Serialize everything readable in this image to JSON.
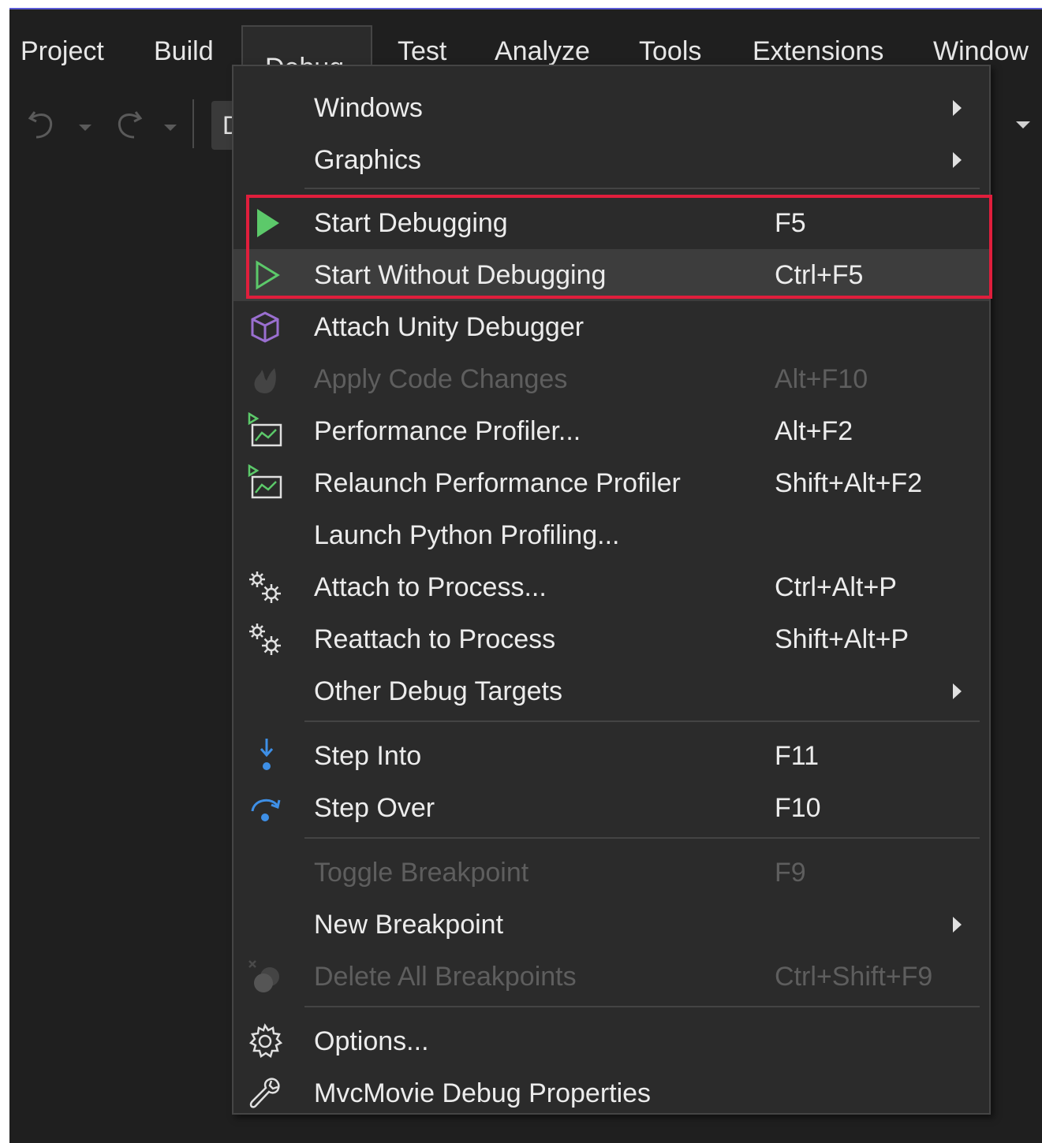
{
  "menubar": {
    "items": [
      "Project",
      "Build",
      "Debug",
      "Test",
      "Analyze",
      "Tools",
      "Extensions",
      "Window"
    ]
  },
  "toolbar": {
    "config_label": "D",
    "icons": [
      "undo-icon",
      "redo-icon"
    ]
  },
  "debug_menu": {
    "items": [
      {
        "label": "Windows",
        "shortcut": "",
        "submenu": true,
        "icon": ""
      },
      {
        "label": "Graphics",
        "shortcut": "",
        "submenu": true,
        "icon": ""
      },
      {
        "label": "Start Debugging",
        "shortcut": "F5",
        "icon": "play-filled-icon"
      },
      {
        "label": "Start Without Debugging",
        "shortcut": "Ctrl+F5",
        "icon": "play-outline-icon"
      },
      {
        "label": "Attach Unity Debugger",
        "shortcut": "",
        "icon": "unity-cube-icon"
      },
      {
        "label": "Apply Code Changes",
        "shortcut": "Alt+F10",
        "icon": "flame-icon",
        "disabled": true
      },
      {
        "label": "Performance Profiler...",
        "shortcut": "Alt+F2",
        "icon": "profiler-icon"
      },
      {
        "label": "Relaunch Performance Profiler",
        "shortcut": "Shift+Alt+F2",
        "icon": "profiler-icon"
      },
      {
        "label": "Launch Python Profiling...",
        "shortcut": "",
        "icon": ""
      },
      {
        "label": "Attach to Process...",
        "shortcut": "Ctrl+Alt+P",
        "icon": "gears-icon"
      },
      {
        "label": "Reattach to Process",
        "shortcut": "Shift+Alt+P",
        "icon": "gears-icon"
      },
      {
        "label": "Other Debug Targets",
        "shortcut": "",
        "submenu": true,
        "icon": ""
      },
      {
        "label": "Step Into",
        "shortcut": "F11",
        "icon": "step-into-icon"
      },
      {
        "label": "Step Over",
        "shortcut": "F10",
        "icon": "step-over-icon"
      },
      {
        "label": "Toggle Breakpoint",
        "shortcut": "F9",
        "icon": "",
        "disabled": true
      },
      {
        "label": "New Breakpoint",
        "shortcut": "",
        "submenu": true,
        "icon": ""
      },
      {
        "label": "Delete All Breakpoints",
        "shortcut": "Ctrl+Shift+F9",
        "icon": "delete-breakpoints-icon",
        "disabled": true
      },
      {
        "label": "Options...",
        "shortcut": "",
        "icon": "gear-icon"
      },
      {
        "label": "MvcMovie Debug Properties",
        "shortcut": "",
        "icon": "wrench-icon"
      }
    ]
  },
  "colors": {
    "accent_highlight": "#e01e3c",
    "play_green": "#5cc96a",
    "unity_purple": "#9a6fd0",
    "step_blue": "#3e8fe6"
  }
}
